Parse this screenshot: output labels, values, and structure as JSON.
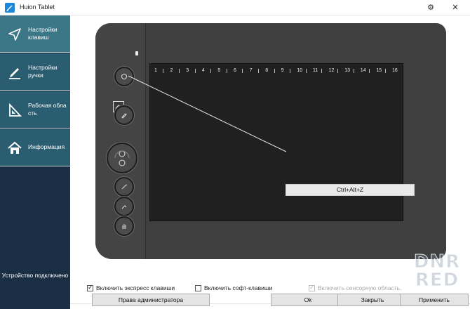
{
  "window": {
    "title": "Huion Tablet",
    "controls": [
      "gear-icon",
      "close-icon"
    ]
  },
  "sidebar": {
    "items": [
      {
        "label": "Настройки клавиш",
        "icon": "send-arrow-icon",
        "active": true
      },
      {
        "label": "Настройки ручки",
        "icon": "pen-icon",
        "active": false
      },
      {
        "label": "Рабочая обла сть",
        "icon": "set-square-icon",
        "active": false
      },
      {
        "label": "Информация",
        "icon": "home-icon",
        "active": false
      }
    ],
    "device_status": "Устройство подключено"
  },
  "tablet": {
    "ruler": [
      "1",
      "2",
      "3",
      "4",
      "5",
      "6",
      "7",
      "8",
      "9",
      "10",
      "11",
      "12",
      "13",
      "14",
      "15",
      "16"
    ],
    "selected_key_shortcut": "Ctrl+Alt+Z"
  },
  "options": {
    "express_keys": {
      "label": "Включить экспресс клавиши",
      "checked": true,
      "enabled": true
    },
    "soft_keys": {
      "label": "Включить софт-клавиши",
      "checked": false,
      "enabled": true
    },
    "touch_area": {
      "label": "Включить сенсорную область.",
      "checked": true,
      "enabled": false
    }
  },
  "buttons": {
    "admin": "Права администратора",
    "ok": "Ok",
    "close": "Закрыть",
    "apply": "Применить"
  },
  "watermark": {
    "line1": "DNR",
    "line2": "RED"
  },
  "colors": {
    "sidebar_bg": "#1b2f44",
    "sidebar_item": "#2a5d6f",
    "sidebar_active": "#3b7787",
    "app_icon": "#1e88d8"
  }
}
